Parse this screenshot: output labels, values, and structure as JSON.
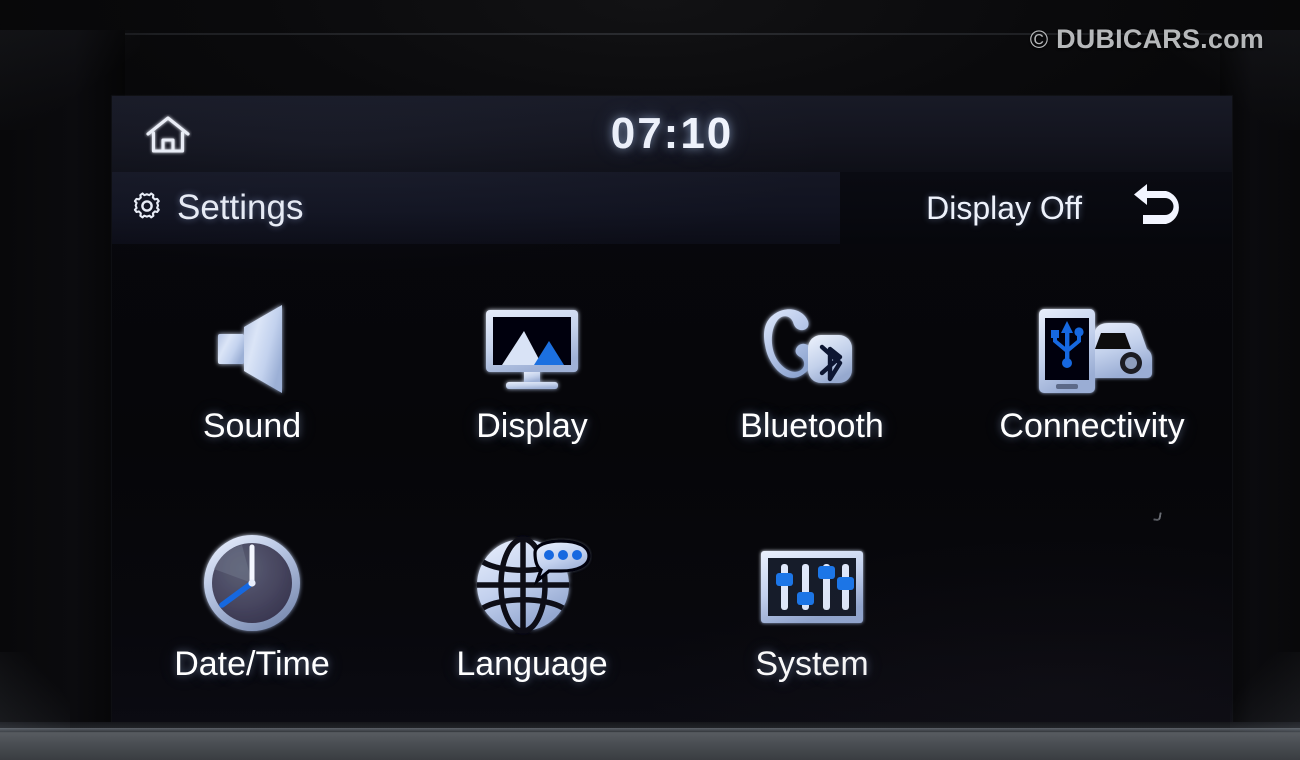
{
  "watermark": {
    "copyright": "©",
    "text": "DUBICARS.com"
  },
  "screen": {
    "statusbar": {
      "home_icon": "home-icon",
      "clock": "07:10"
    },
    "titlebar": {
      "gear_icon": "gear-icon",
      "title": "Settings",
      "display_off_label": "Display Off",
      "back_icon": "back-arrow-icon"
    },
    "menu": {
      "items": [
        {
          "label": "Sound",
          "icon": "speaker-icon"
        },
        {
          "label": "Display",
          "icon": "monitor-picture-icon"
        },
        {
          "label": "Bluetooth",
          "icon": "phone-bluetooth-icon"
        },
        {
          "label": "Connectivity",
          "icon": "phone-usb-car-icon"
        },
        {
          "label": "Date/Time",
          "icon": "analog-clock-icon"
        },
        {
          "label": "Language",
          "icon": "globe-speech-bubble-icon"
        },
        {
          "label": "System",
          "icon": "sliders-panel-icon"
        }
      ]
    }
  },
  "colors": {
    "screen_bg": "#06070c",
    "statusbar_bg": "#13141e",
    "text_primary": "#ffffff",
    "accent_blue": "#1f6fe0",
    "icon_silver": "#dfe6f5",
    "bezel_bottom": "#4a4e53",
    "watermark_gray": "#b6b8ba"
  }
}
